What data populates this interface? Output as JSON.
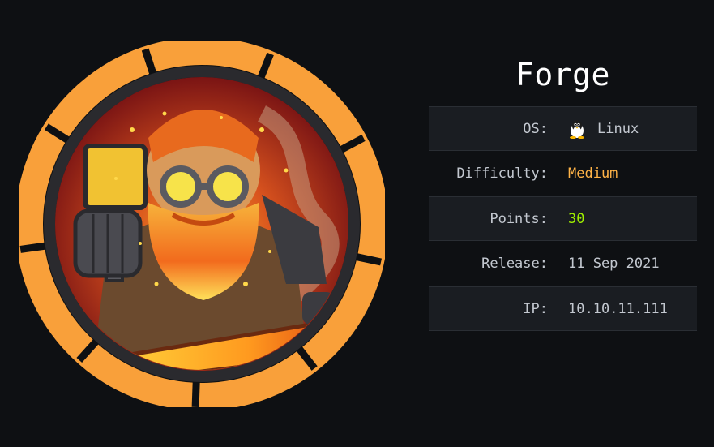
{
  "machine": {
    "name": "Forge"
  },
  "info": {
    "os_label": "OS:",
    "os_value": "Linux",
    "os_icon": "linux-tux-icon",
    "difficulty_label": "Difficulty:",
    "difficulty_value": "Medium",
    "points_label": "Points:",
    "points_value": "30",
    "release_label": "Release:",
    "release_value": "11 Sep 2021",
    "ip_label": "IP:",
    "ip_value": "10.10.11.111"
  },
  "colors": {
    "background": "#0e1013",
    "row_shade": "#1a1d22",
    "badge_ring": "#f9a03a",
    "difficulty_medium": "#ffb347",
    "points": "#9fef00",
    "title": "#ffffff"
  }
}
